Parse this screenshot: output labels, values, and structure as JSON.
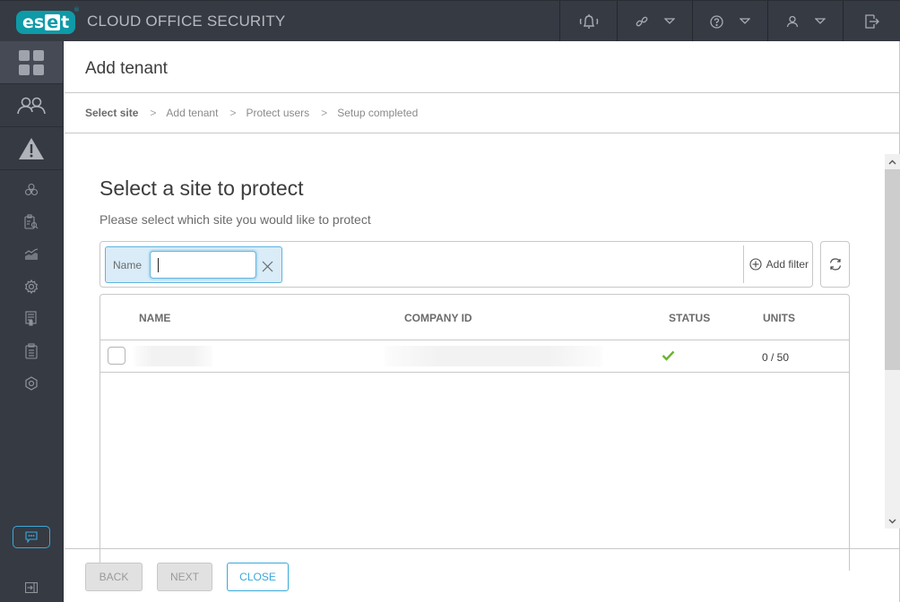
{
  "app": {
    "logo_text": "eset",
    "title": "CLOUD OFFICE SECURITY"
  },
  "topbar": {
    "buttons": [
      {
        "name": "notifications",
        "icon": "bell-icon",
        "has_dropdown": false
      },
      {
        "name": "links",
        "icon": "link-icon",
        "has_dropdown": true
      },
      {
        "name": "help",
        "icon": "help-icon",
        "has_dropdown": true
      },
      {
        "name": "user",
        "icon": "user-icon",
        "has_dropdown": true
      },
      {
        "name": "logout",
        "icon": "logout-icon",
        "has_dropdown": false
      }
    ]
  },
  "sidebar": {
    "items": [
      {
        "name": "dashboard",
        "icon": "dashboard-grid-icon",
        "active": true
      },
      {
        "name": "users",
        "icon": "users-icon"
      },
      {
        "name": "alerts",
        "icon": "warning-icon"
      },
      {
        "name": "quarantine",
        "icon": "biohazard-icon"
      },
      {
        "name": "audit",
        "icon": "clipboard-search-icon"
      },
      {
        "name": "statistics",
        "icon": "chart-icon"
      },
      {
        "name": "policies",
        "icon": "gear-icon"
      },
      {
        "name": "license",
        "icon": "license-icon"
      },
      {
        "name": "logs",
        "icon": "clipboard-list-icon"
      },
      {
        "name": "settings",
        "icon": "settings-icon"
      }
    ],
    "feedback_icon": "chat-icon",
    "collapse_icon": "collapse-icon"
  },
  "page": {
    "title": "Add tenant",
    "breadcrumb": [
      "Select site",
      "Add tenant",
      "Protect users",
      "Setup completed"
    ],
    "active_step": 0
  },
  "section": {
    "title": "Select a site to protect",
    "subtitle": "Please select which site you would like to protect"
  },
  "filter": {
    "chip_label": "Name",
    "value": "",
    "placeholder": "",
    "add_filter_label": "Add filter"
  },
  "table": {
    "columns": [
      "NAME",
      "COMPANY ID",
      "STATUS",
      "UNITS"
    ],
    "rows": [
      {
        "name": "",
        "company_id": "",
        "status": "ok",
        "units": "0 / 50",
        "name_redacted": true,
        "company_id_redacted": true
      }
    ]
  },
  "scrollbar": {
    "position": 0.0
  },
  "footer": {
    "back_label": "BACK",
    "next_label": "NEXT",
    "close_label": "CLOSE"
  },
  "colors": {
    "brand": "#0e9aa7",
    "accent": "#3aa9d9",
    "success": "#6ab42d",
    "topbar_bg": "#363a43"
  }
}
